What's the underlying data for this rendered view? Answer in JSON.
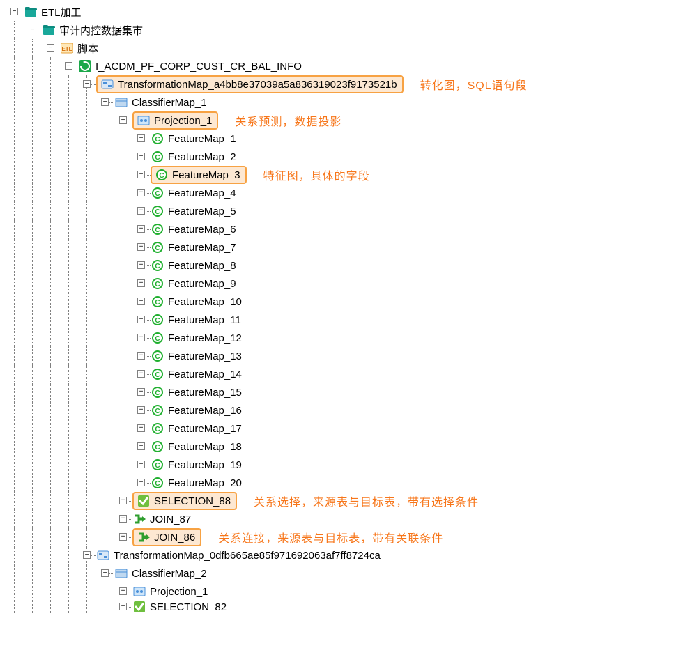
{
  "tree": {
    "root": {
      "label": "ETL加工"
    },
    "level1": {
      "label": "审计内控数据集市"
    },
    "scripts": {
      "label": "脚本"
    },
    "job": {
      "label": "I_ACDM_PF_CORP_CUST_CR_BAL_INFO"
    },
    "tmap1": {
      "label": "TransformationMap_a4bb8e37039a5a836319023f9173521b"
    },
    "cmap1": {
      "label": "ClassifierMap_1"
    },
    "proj1": {
      "label": "Projection_1"
    },
    "features": [
      "FeatureMap_1",
      "FeatureMap_2",
      "FeatureMap_3",
      "FeatureMap_4",
      "FeatureMap_5",
      "FeatureMap_6",
      "FeatureMap_7",
      "FeatureMap_8",
      "FeatureMap_9",
      "FeatureMap_10",
      "FeatureMap_11",
      "FeatureMap_12",
      "FeatureMap_13",
      "FeatureMap_14",
      "FeatureMap_15",
      "FeatureMap_16",
      "FeatureMap_17",
      "FeatureMap_18",
      "FeatureMap_19",
      "FeatureMap_20"
    ],
    "sel88": {
      "label": "SELECTION_88"
    },
    "join87": {
      "label": "JOIN_87"
    },
    "join86": {
      "label": "JOIN_86"
    },
    "tmap2": {
      "label": "TransformationMap_0dfb665ae85f971692063af7ff8724ca"
    },
    "cmap2": {
      "label": "ClassifierMap_2"
    },
    "proj2": {
      "label": "Projection_1"
    },
    "sel82": {
      "label": "SELECTION_82"
    }
  },
  "annotations": {
    "tmap": "转化图，SQL语句段",
    "proj": "关系预测，数据投影",
    "feat": "特征图，具体的字段",
    "sel": "关系选择，来源表与目标表，带有选择条件",
    "join": "关系连接，来源表与目标表，带有关联条件"
  }
}
